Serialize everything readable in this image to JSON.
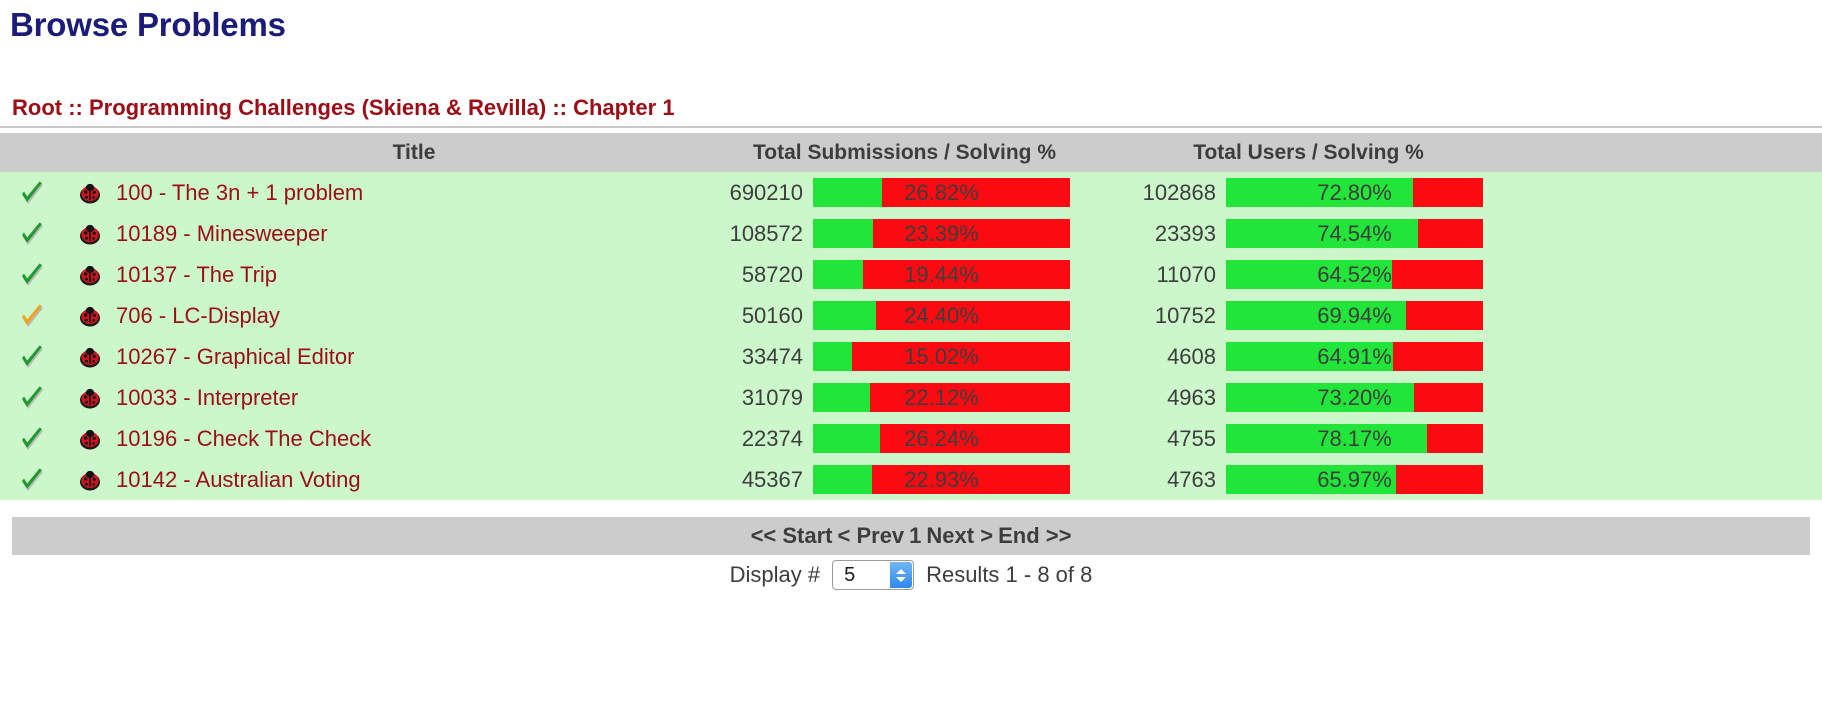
{
  "page": {
    "title": "Browse Problems",
    "breadcrumb": "Root :: Programming Challenges (Skiena & Revilla) :: Chapter 1"
  },
  "table": {
    "headers": {
      "title": "Title",
      "submissions": "Total Submissions / Solving %",
      "users": "Total Users / Solving %"
    },
    "rows": [
      {
        "solved_icon": "green-check-icon",
        "bug_icon": "ladybug-icon",
        "title": "100 - The 3n + 1 problem",
        "total_submissions": "690210",
        "submissions_pct_label": "26.82%",
        "submissions_pct": 26.82,
        "total_users": "102868",
        "users_pct_label": "72.80%",
        "users_pct": 72.8
      },
      {
        "solved_icon": "green-check-icon",
        "bug_icon": "ladybug-icon",
        "title": "10189 - Minesweeper",
        "total_submissions": "108572",
        "submissions_pct_label": "23.39%",
        "submissions_pct": 23.39,
        "total_users": "23393",
        "users_pct_label": "74.54%",
        "users_pct": 74.54
      },
      {
        "solved_icon": "green-check-icon",
        "bug_icon": "ladybug-icon",
        "title": "10137 - The Trip",
        "total_submissions": "58720",
        "submissions_pct_label": "19.44%",
        "submissions_pct": 19.44,
        "total_users": "11070",
        "users_pct_label": "64.52%",
        "users_pct": 64.52
      },
      {
        "solved_icon": "orange-check-icon",
        "bug_icon": "ladybug-icon",
        "title": "706 - LC-Display",
        "total_submissions": "50160",
        "submissions_pct_label": "24.40%",
        "submissions_pct": 24.4,
        "total_users": "10752",
        "users_pct_label": "69.94%",
        "users_pct": 69.94
      },
      {
        "solved_icon": "green-check-icon",
        "bug_icon": "ladybug-icon",
        "title": "10267 - Graphical Editor",
        "total_submissions": "33474",
        "submissions_pct_label": "15.02%",
        "submissions_pct": 15.02,
        "total_users": "4608",
        "users_pct_label": "64.91%",
        "users_pct": 64.91
      },
      {
        "solved_icon": "green-check-icon",
        "bug_icon": "ladybug-icon",
        "title": "10033 - Interpreter",
        "total_submissions": "31079",
        "submissions_pct_label": "22.12%",
        "submissions_pct": 22.12,
        "total_users": "4963",
        "users_pct_label": "73.20%",
        "users_pct": 73.2
      },
      {
        "solved_icon": "green-check-icon",
        "bug_icon": "ladybug-icon",
        "title": "10196 - Check The Check",
        "total_submissions": "22374",
        "submissions_pct_label": "26.24%",
        "submissions_pct": 26.24,
        "total_users": "4755",
        "users_pct_label": "78.17%",
        "users_pct": 78.17
      },
      {
        "solved_icon": "green-check-icon",
        "bug_icon": "ladybug-icon",
        "title": "10142 - Australian Voting",
        "total_submissions": "45367",
        "submissions_pct_label": "22.93%",
        "submissions_pct": 22.93,
        "total_users": "4763",
        "users_pct_label": "65.97%",
        "users_pct": 65.97
      }
    ]
  },
  "pager": {
    "start": "<< Start",
    "prev": "< Prev",
    "page": "1",
    "next": "Next >",
    "end": "End >>"
  },
  "footer": {
    "display_label": "Display #",
    "display_value": "5",
    "results_text": "Results 1 - 8 of 8"
  },
  "colors": {
    "title": "#1b1b7a",
    "link": "#9c0d16",
    "header_bg": "#cccccc",
    "row_bg": "#ccf7cb",
    "bar_green": "#22e53a",
    "bar_red": "#fb0a12"
  },
  "chart_data": {
    "type": "bar",
    "title": "Solving % per problem",
    "categories": [
      "100 - The 3n + 1 problem",
      "10189 - Minesweeper",
      "10137 - The Trip",
      "706 - LC-Display",
      "10267 - Graphical Editor",
      "10033 - Interpreter",
      "10196 - Check The Check",
      "10142 - Australian Voting"
    ],
    "series": [
      {
        "name": "Total Submissions / Solving %",
        "values": [
          26.82,
          23.39,
          19.44,
          24.4,
          15.02,
          22.12,
          26.24,
          22.93
        ]
      },
      {
        "name": "Total Users / Solving %",
        "values": [
          72.8,
          74.54,
          64.52,
          69.94,
          64.91,
          73.2,
          78.17,
          65.97
        ]
      }
    ],
    "counts": {
      "total_submissions": [
        690210,
        108572,
        58720,
        50160,
        33474,
        31079,
        22374,
        45367
      ],
      "total_users": [
        102868,
        23393,
        11070,
        10752,
        4608,
        4963,
        4755,
        4763
      ]
    },
    "xlabel": "",
    "ylabel": "Solving %",
    "ylim": [
      0,
      100
    ],
    "grid": false,
    "legend": "none"
  }
}
